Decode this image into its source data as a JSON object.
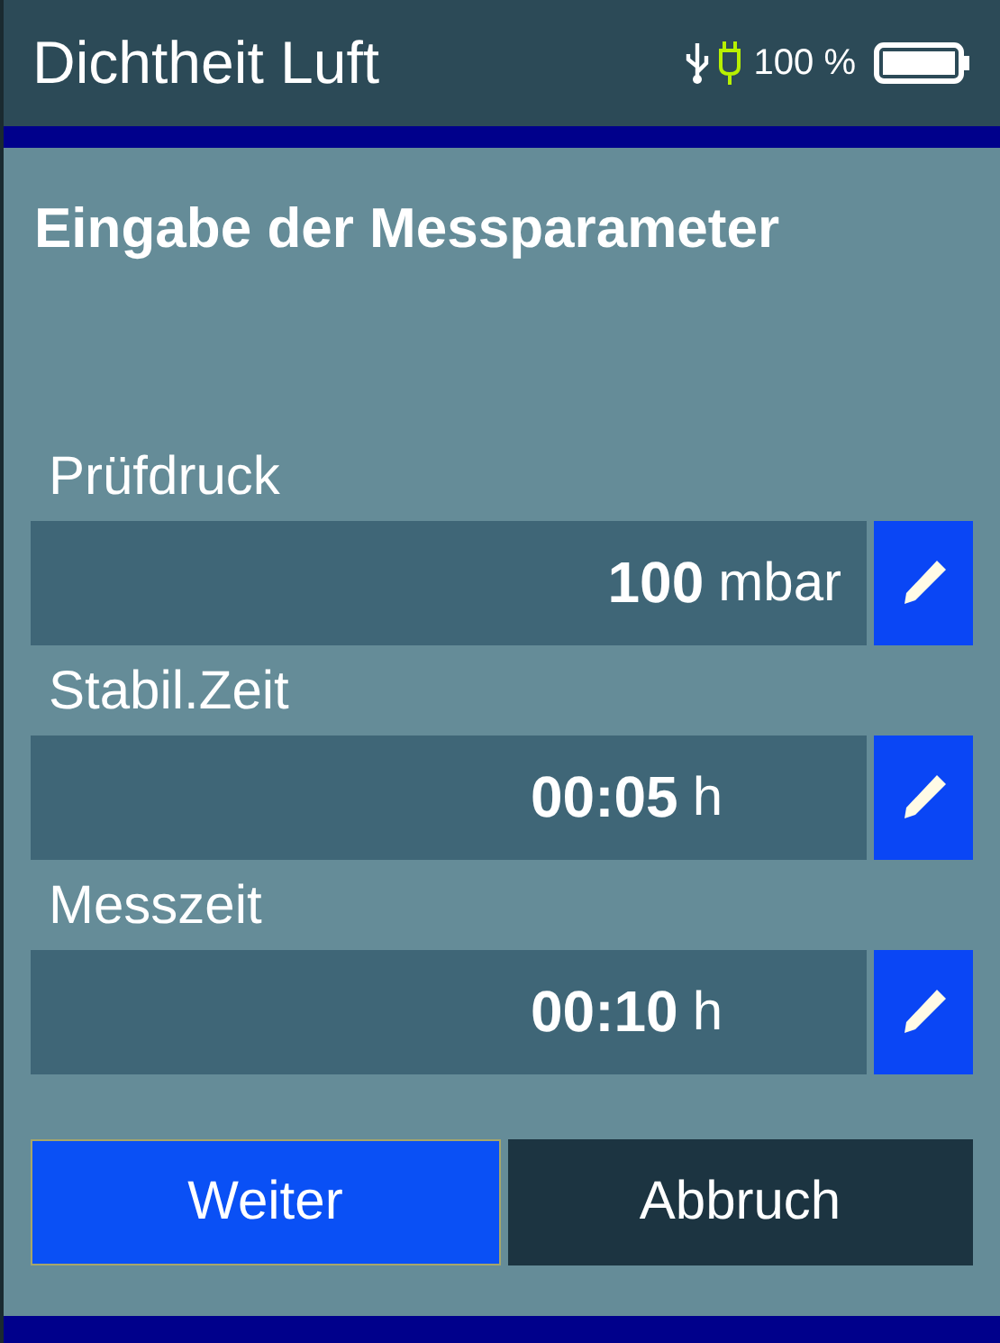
{
  "header": {
    "title": "Dichtheit Luft",
    "battery_text": "100 %"
  },
  "heading": "Eingabe der Messparameter",
  "parameters": [
    {
      "label": "Prüfdruck",
      "value": "100",
      "unit": "mbar"
    },
    {
      "label": "Stabil.Zeit",
      "value": "00:05",
      "unit": "h"
    },
    {
      "label": "Messzeit",
      "value": "00:10",
      "unit": "h"
    }
  ],
  "buttons": [
    {
      "label": "Weiter",
      "selected": true
    },
    {
      "label": "Abbruch",
      "selected": false
    }
  ]
}
